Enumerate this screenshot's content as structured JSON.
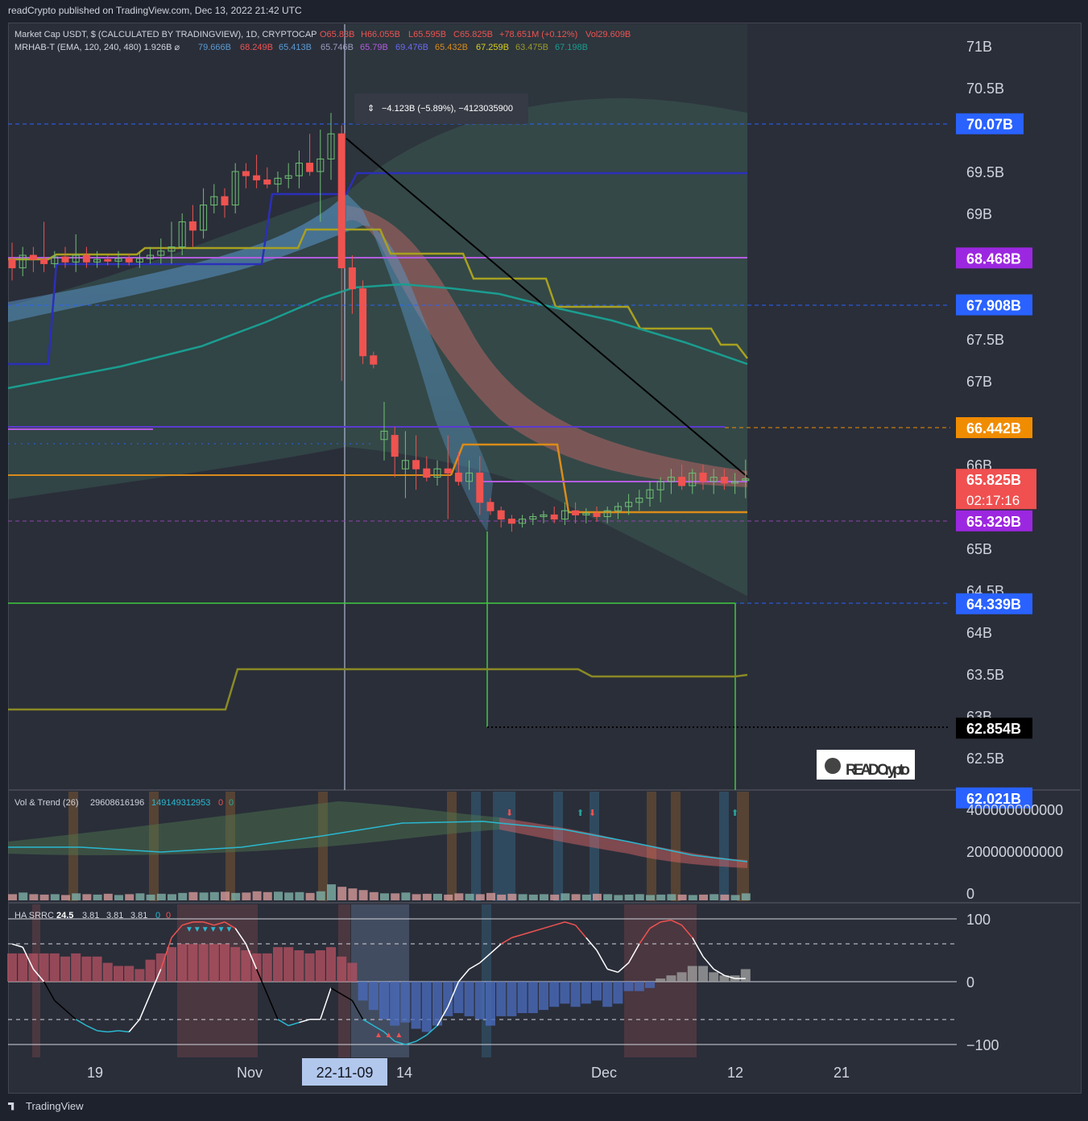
{
  "header_text": "readCrypto published on TradingView.com, Dec 13, 2022 21:42 UTC",
  "footer_text": "TradingView",
  "legend": {
    "line1_label": "Market Cap USDT, $ (CALCULATED BY TRADINGVIEW), 1D, CRYPTOCAP",
    "o": "O65.83B",
    "h": "H66.055B",
    "l": "L65.595B",
    "c": "C65.825B",
    "chg": "+78.651M (+0.12%)",
    "vol": "Vol29.609B",
    "line2_label": "MRHAB-T (EMA, 120, 240, 480)  1.926B  ⌀",
    "v1": "79.666B",
    "v2": "68.249B",
    "v3": "65.413B",
    "v4": "65.746B",
    "v5": "65.79B",
    "v6": "69.476B",
    "v7": "65.432B",
    "v8": "67.259B",
    "v9": "63.475B",
    "v10": "67.198B"
  },
  "measure_tooltip": "−4.123B (−5.89%), −4123035900",
  "watermark": "READ Crypto",
  "vol_panel": {
    "label": "Vol & Trend (26)",
    "v1": "29608616196",
    "v2": "149149312953",
    "v3": "0",
    "v4": "0"
  },
  "sr_panel": {
    "label": "HA SRRC",
    "v1": "24.5",
    "v2": "3.81",
    "v3": "3.81",
    "v4": "3.81",
    "v5": "0",
    "v6": "0"
  },
  "colors": {
    "bg": "#2a2e39",
    "up": "#26a69a",
    "down": "#ef5350",
    "blue_line": "#2b2fb8",
    "olive": "#9a9a2a",
    "teal": "#1a9d8f",
    "orange": "#d98c1a",
    "purple": "#b35ce0",
    "green_line": "#3ec93e"
  },
  "chart_data": [
    {
      "type": "candlestick",
      "title": "Market Cap USDT, $ (CALCULATED BY TRADINGVIEW), 1D, CRYPTOCAP",
      "ylim": [
        62.1,
        71.3
      ],
      "y_ticks": [
        "71B",
        "70.5B",
        "69.5B",
        "69B",
        "67.5B",
        "67B",
        "66B",
        "65B",
        "64.5B",
        "64B",
        "63.5B",
        "63B",
        "62.5B"
      ],
      "x_ticks": [
        "19",
        "Nov",
        "22-11-09",
        "14",
        "Dec",
        "12",
        "21"
      ],
      "price_labels": [
        {
          "text": "70.07B",
          "value": 70.07,
          "color": "#2962ff"
        },
        {
          "text": "68.468B",
          "value": 68.468,
          "color": "#9c27e0"
        },
        {
          "text": "67.908B",
          "value": 67.908,
          "color": "#2962ff"
        },
        {
          "text": "66.442B",
          "value": 66.442,
          "color": "#f08c00"
        },
        {
          "text": "65.825B",
          "value": 65.825,
          "color": "#f05050",
          "sub": "02:17:16"
        },
        {
          "text": "65.329B",
          "value": 65.329,
          "color": "#9c27e0"
        },
        {
          "text": "64.339B",
          "value": 64.339,
          "color": "#2962ff"
        },
        {
          "text": "62.854B",
          "value": 62.854,
          "color": "#000000"
        },
        {
          "text": "62.021B",
          "value": 62.021,
          "color": "#2962ff"
        }
      ],
      "candles": [
        {
          "x": 0,
          "o": 68.45,
          "h": 68.65,
          "l": 68.2,
          "c": 68.35
        },
        {
          "x": 1,
          "o": 68.35,
          "h": 68.6,
          "l": 68.25,
          "c": 68.5
        },
        {
          "x": 2,
          "o": 68.5,
          "h": 68.6,
          "l": 68.3,
          "c": 68.45
        },
        {
          "x": 3,
          "o": 68.45,
          "h": 68.9,
          "l": 68.3,
          "c": 68.4
        },
        {
          "x": 4,
          "o": 68.4,
          "h": 68.55,
          "l": 68.35,
          "c": 68.48
        },
        {
          "x": 5,
          "o": 68.48,
          "h": 68.6,
          "l": 68.35,
          "c": 68.42
        },
        {
          "x": 6,
          "o": 68.42,
          "h": 68.75,
          "l": 68.3,
          "c": 68.5
        },
        {
          "x": 7,
          "o": 68.5,
          "h": 68.6,
          "l": 68.35,
          "c": 68.42
        },
        {
          "x": 8,
          "o": 68.42,
          "h": 68.55,
          "l": 68.35,
          "c": 68.45
        },
        {
          "x": 9,
          "o": 68.45,
          "h": 68.5,
          "l": 68.38,
          "c": 68.43
        },
        {
          "x": 10,
          "o": 68.43,
          "h": 68.55,
          "l": 68.35,
          "c": 68.46
        },
        {
          "x": 11,
          "o": 68.46,
          "h": 68.52,
          "l": 68.38,
          "c": 68.42
        },
        {
          "x": 12,
          "o": 68.42,
          "h": 68.55,
          "l": 68.35,
          "c": 68.46
        },
        {
          "x": 13,
          "o": 68.46,
          "h": 68.6,
          "l": 68.4,
          "c": 68.5
        },
        {
          "x": 14,
          "o": 68.5,
          "h": 68.7,
          "l": 68.4,
          "c": 68.55
        },
        {
          "x": 15,
          "o": 68.55,
          "h": 68.9,
          "l": 68.4,
          "c": 68.6
        },
        {
          "x": 16,
          "o": 68.6,
          "h": 69.0,
          "l": 68.5,
          "c": 68.9
        },
        {
          "x": 17,
          "o": 68.9,
          "h": 69.1,
          "l": 68.6,
          "c": 68.8
        },
        {
          "x": 18,
          "o": 68.8,
          "h": 69.3,
          "l": 68.7,
          "c": 69.1
        },
        {
          "x": 19,
          "o": 69.1,
          "h": 69.35,
          "l": 69.0,
          "c": 69.2
        },
        {
          "x": 20,
          "o": 69.2,
          "h": 69.3,
          "l": 68.95,
          "c": 69.1
        },
        {
          "x": 21,
          "o": 69.1,
          "h": 69.6,
          "l": 69.0,
          "c": 69.5
        },
        {
          "x": 22,
          "o": 69.5,
          "h": 69.6,
          "l": 69.3,
          "c": 69.45
        },
        {
          "x": 23,
          "o": 69.45,
          "h": 69.7,
          "l": 69.3,
          "c": 69.4
        },
        {
          "x": 24,
          "o": 69.4,
          "h": 69.55,
          "l": 69.3,
          "c": 69.35
        },
        {
          "x": 25,
          "o": 69.35,
          "h": 69.5,
          "l": 69.25,
          "c": 69.42
        },
        {
          "x": 26,
          "o": 69.42,
          "h": 69.6,
          "l": 69.3,
          "c": 69.45
        },
        {
          "x": 27,
          "o": 69.45,
          "h": 69.75,
          "l": 69.3,
          "c": 69.6
        },
        {
          "x": 28,
          "o": 69.6,
          "h": 69.95,
          "l": 69.45,
          "c": 69.5
        },
        {
          "x": 29,
          "o": 69.5,
          "h": 70.0,
          "l": 68.9,
          "c": 69.65
        },
        {
          "x": 30,
          "o": 69.65,
          "h": 70.2,
          "l": 69.4,
          "c": 69.95
        },
        {
          "x": 31,
          "o": 69.95,
          "h": 70.05,
          "l": 67.0,
          "c": 68.35
        },
        {
          "x": 32,
          "o": 68.35,
          "h": 68.5,
          "l": 67.8,
          "c": 68.1
        },
        {
          "x": 33,
          "o": 68.1,
          "h": 68.2,
          "l": 67.2,
          "c": 67.3
        },
        {
          "x": 34,
          "o": 67.3,
          "h": 67.35,
          "l": 67.15,
          "c": 67.2
        },
        {
          "x": 35,
          "o": 66.3,
          "h": 66.75,
          "l": 66.05,
          "c": 66.4
        },
        {
          "x": 36,
          "o": 66.35,
          "h": 66.45,
          "l": 65.85,
          "c": 66.1
        },
        {
          "x": 37,
          "o": 65.95,
          "h": 66.4,
          "l": 65.6,
          "c": 66.05
        },
        {
          "x": 38,
          "o": 66.05,
          "h": 66.35,
          "l": 65.7,
          "c": 65.95
        },
        {
          "x": 39,
          "o": 65.95,
          "h": 66.1,
          "l": 65.8,
          "c": 65.85
        },
        {
          "x": 40,
          "o": 65.85,
          "h": 66.05,
          "l": 65.75,
          "c": 65.95
        },
        {
          "x": 41,
          "o": 65.95,
          "h": 66.35,
          "l": 65.35,
          "c": 65.9
        },
        {
          "x": 42,
          "o": 65.9,
          "h": 66.15,
          "l": 65.75,
          "c": 65.8
        },
        {
          "x": 43,
          "o": 65.8,
          "h": 66.05,
          "l": 65.7,
          "c": 65.9
        },
        {
          "x": 44,
          "o": 65.9,
          "h": 66.1,
          "l": 65.4,
          "c": 65.55
        },
        {
          "x": 45,
          "o": 65.55,
          "h": 65.6,
          "l": 65.4,
          "c": 65.45
        },
        {
          "x": 46,
          "o": 65.45,
          "h": 65.5,
          "l": 65.25,
          "c": 65.35
        },
        {
          "x": 47,
          "o": 65.35,
          "h": 65.4,
          "l": 65.2,
          "c": 65.3
        },
        {
          "x": 48,
          "o": 65.3,
          "h": 65.4,
          "l": 65.25,
          "c": 65.35
        },
        {
          "x": 49,
          "o": 65.35,
          "h": 65.42,
          "l": 65.28,
          "c": 65.38
        },
        {
          "x": 50,
          "o": 65.38,
          "h": 65.45,
          "l": 65.3,
          "c": 65.4
        },
        {
          "x": 51,
          "o": 65.4,
          "h": 65.5,
          "l": 65.3,
          "c": 65.35
        },
        {
          "x": 52,
          "o": 65.35,
          "h": 65.55,
          "l": 65.28,
          "c": 65.45
        },
        {
          "x": 53,
          "o": 65.45,
          "h": 65.55,
          "l": 65.3,
          "c": 65.4
        },
        {
          "x": 54,
          "o": 65.4,
          "h": 65.48,
          "l": 65.3,
          "c": 65.42
        },
        {
          "x": 55,
          "o": 65.42,
          "h": 65.5,
          "l": 65.32,
          "c": 65.38
        },
        {
          "x": 56,
          "o": 65.38,
          "h": 65.5,
          "l": 65.3,
          "c": 65.45
        },
        {
          "x": 57,
          "o": 65.45,
          "h": 65.55,
          "l": 65.35,
          "c": 65.5
        },
        {
          "x": 58,
          "o": 65.5,
          "h": 65.65,
          "l": 65.4,
          "c": 65.55
        },
        {
          "x": 59,
          "o": 65.55,
          "h": 65.7,
          "l": 65.45,
          "c": 65.6
        },
        {
          "x": 60,
          "o": 65.6,
          "h": 65.8,
          "l": 65.5,
          "c": 65.7
        },
        {
          "x": 61,
          "o": 65.7,
          "h": 65.85,
          "l": 65.55,
          "c": 65.8
        },
        {
          "x": 62,
          "o": 65.8,
          "h": 65.95,
          "l": 65.65,
          "c": 65.85
        },
        {
          "x": 63,
          "o": 65.85,
          "h": 66.0,
          "l": 65.7,
          "c": 65.75
        },
        {
          "x": 64,
          "o": 65.75,
          "h": 65.95,
          "l": 65.65,
          "c": 65.9
        },
        {
          "x": 65,
          "o": 65.9,
          "h": 66.0,
          "l": 65.7,
          "c": 65.8
        },
        {
          "x": 66,
          "o": 65.8,
          "h": 65.95,
          "l": 65.65,
          "c": 65.85
        },
        {
          "x": 67,
          "o": 65.85,
          "h": 65.95,
          "l": 65.7,
          "c": 65.78
        },
        {
          "x": 68,
          "o": 65.78,
          "h": 65.9,
          "l": 65.65,
          "c": 65.8
        },
        {
          "x": 69,
          "o": 65.83,
          "h": 66.06,
          "l": 65.6,
          "c": 65.83
        }
      ]
    },
    {
      "type": "bar",
      "title": "Vol & Trend (26)",
      "y_ticks": [
        "400000000000",
        "200000000000",
        "0"
      ],
      "ylim": [
        0,
        440000000000
      ],
      "values_billions": [
        30,
        38,
        30,
        28,
        30,
        26,
        34,
        30,
        28,
        32,
        26,
        30,
        34,
        28,
        32,
        30,
        36,
        40,
        38,
        40,
        42,
        36,
        38,
        44,
        40,
        42,
        38,
        40,
        36,
        44,
        78,
        66,
        58,
        50,
        40,
        34,
        34,
        38,
        30,
        32,
        32,
        28,
        34,
        32,
        30,
        36,
        28,
        32,
        30,
        28,
        30,
        28,
        34,
        30,
        28,
        32,
        30,
        26,
        28,
        30,
        26,
        28,
        30,
        28,
        26,
        28,
        30,
        28,
        26,
        34
      ]
    },
    {
      "type": "line",
      "title": "HA SRRC",
      "y_ticks": [
        "100",
        "0",
        "−100"
      ],
      "ylim": [
        -105,
        105
      ],
      "oscillator": [
        60,
        55,
        20,
        0,
        -30,
        -45,
        -60,
        -70,
        -78,
        -80,
        -78,
        -80,
        -60,
        -20,
        20,
        70,
        90,
        95,
        95,
        90,
        95,
        85,
        60,
        20,
        -20,
        -60,
        -70,
        -65,
        -60,
        -60,
        -10,
        -20,
        -30,
        -60,
        -70,
        -80,
        -95,
        -100,
        -95,
        -85,
        -70,
        -40,
        0,
        20,
        30,
        45,
        60,
        70,
        75,
        80,
        85,
        90,
        95,
        90,
        70,
        50,
        20,
        15,
        30,
        60,
        85,
        95,
        98,
        90,
        70,
        40,
        20,
        10,
        5,
        5
      ],
      "histogram": [
        45,
        45,
        45,
        45,
        45,
        40,
        45,
        40,
        40,
        30,
        25,
        25,
        20,
        35,
        45,
        55,
        60,
        60,
        60,
        60,
        60,
        55,
        50,
        45,
        45,
        55,
        55,
        50,
        45,
        50,
        55,
        40,
        30,
        -30,
        -45,
        -60,
        -70,
        -65,
        -75,
        -80,
        -70,
        -55,
        -50,
        -55,
        -60,
        -70,
        -55,
        -55,
        -50,
        -50,
        -45,
        -40,
        -35,
        -40,
        -35,
        -30,
        -40,
        -35,
        -15,
        -15,
        -10,
        5,
        10,
        15,
        25,
        25,
        15,
        10,
        10,
        20
      ]
    }
  ]
}
